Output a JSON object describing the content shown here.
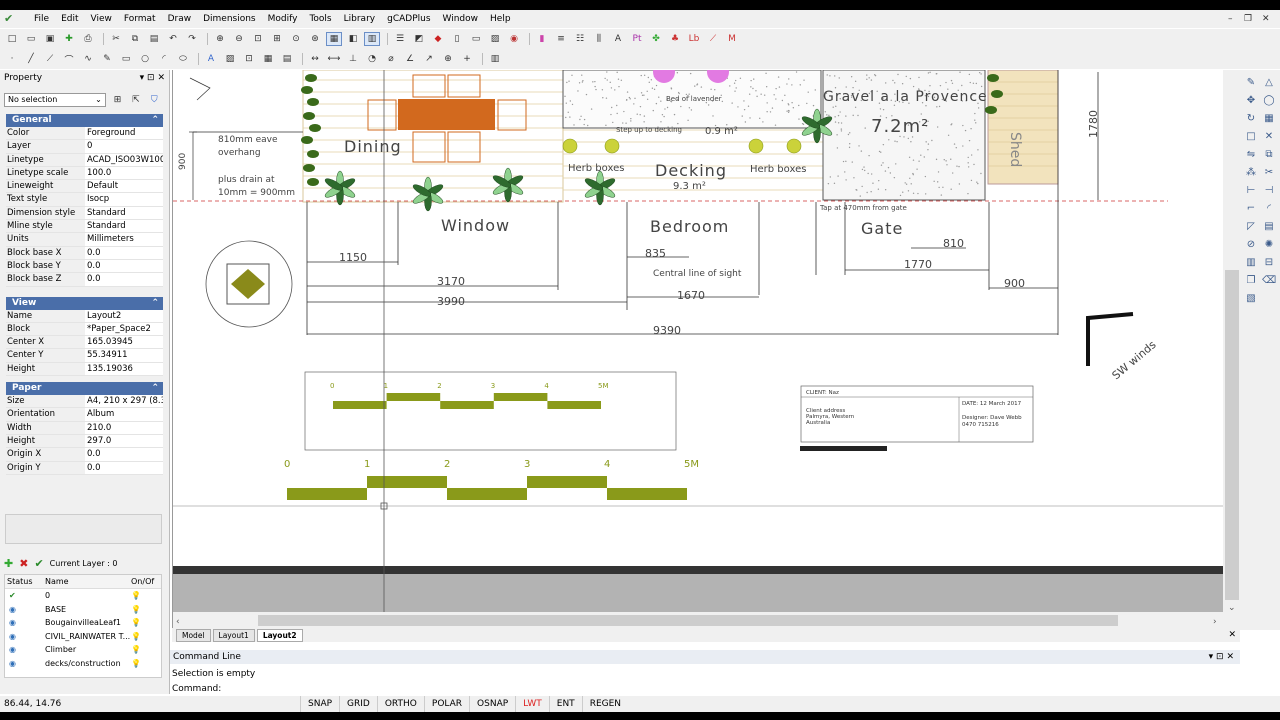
{
  "menu": [
    "File",
    "Edit",
    "View",
    "Format",
    "Draw",
    "Dimensions",
    "Modify",
    "Tools",
    "Library",
    "gCADPlus",
    "Window",
    "Help"
  ],
  "property_panel": {
    "title": "Property",
    "selection": "No selection",
    "general": {
      "title": "General",
      "rows": [
        {
          "k": "Color",
          "v": "Foreground"
        },
        {
          "k": "Layer",
          "v": "0"
        },
        {
          "k": "Linetype",
          "v": "ACAD_ISO03W100"
        },
        {
          "k": "Linetype scale",
          "v": "100.0"
        },
        {
          "k": "Lineweight",
          "v": "Default"
        },
        {
          "k": "Text style",
          "v": "Isocp"
        },
        {
          "k": "Dimension style",
          "v": "Standard"
        },
        {
          "k": "Mline style",
          "v": "Standard"
        },
        {
          "k": "Units",
          "v": "Millimeters"
        },
        {
          "k": "Block base X",
          "v": "0.0"
        },
        {
          "k": "Block base Y",
          "v": "0.0"
        },
        {
          "k": "Block base Z",
          "v": "0.0"
        }
      ]
    },
    "view": {
      "title": "View",
      "rows": [
        {
          "k": "Name",
          "v": "Layout2"
        },
        {
          "k": "Block",
          "v": "*Paper_Space2"
        },
        {
          "k": "Center X",
          "v": "165.03945"
        },
        {
          "k": "Center Y",
          "v": "55.34911"
        },
        {
          "k": "Height",
          "v": "135.19036"
        }
      ]
    },
    "paper": {
      "title": "Paper",
      "rows": [
        {
          "k": "Size",
          "v": "A4, 210 x 297 (8.3 x"
        },
        {
          "k": "Orientation",
          "v": "Album"
        },
        {
          "k": "Width",
          "v": "210.0"
        },
        {
          "k": "Height",
          "v": "297.0"
        },
        {
          "k": "Origin X",
          "v": "0.0"
        },
        {
          "k": "Origin Y",
          "v": "0.0"
        }
      ]
    }
  },
  "layers": {
    "current_label": "Current Layer : 0",
    "headers": [
      "Status",
      "Name",
      "On/Of"
    ],
    "rows": [
      {
        "status": "✔",
        "name": "0"
      },
      {
        "status": "",
        "name": "BASE"
      },
      {
        "status": "",
        "name": "BougainvilleaLeaf1"
      },
      {
        "status": "",
        "name": "CIVIL_RAINWATER T..."
      },
      {
        "status": "",
        "name": "Climber"
      },
      {
        "status": "",
        "name": "decks/construction"
      }
    ]
  },
  "drawing": {
    "labels": {
      "dining": "Dining",
      "decking": "Decking",
      "decking_area": "9.3 m²",
      "gravel": "Gravel a la Provence",
      "gravel_area": "7.2m²",
      "herb1": "Herb boxes",
      "herb2": "Herb boxes",
      "bed_lavender": "Bed of lavender",
      "step_decking": "Step up to decking",
      "area_small": "0.9 m²",
      "shed": "Shed",
      "window": "Window",
      "bedroom": "Bedroom",
      "gate": "Gate",
      "tap": "Tap at 470mm from gate",
      "eave1": "810mm eave",
      "eave2": "overhang",
      "drain1": "plus drain at",
      "drain2": "10mm = 900mm",
      "side_900": "900",
      "central": "Central line of sight",
      "sw": "SW winds",
      "dim_1780": "1780"
    },
    "dims": {
      "d1150": "1150",
      "d3170": "3170",
      "d3990": "3990",
      "d835": "835",
      "d1670": "1670",
      "d9390": "9390",
      "d810": "810",
      "d1770": "1770",
      "d900": "900"
    },
    "scale_small": [
      "0",
      "1",
      "2",
      "3",
      "4",
      "5M"
    ],
    "scale_large": [
      "0",
      "1",
      "2",
      "3",
      "4",
      "5M"
    ],
    "title_block": {
      "client": "CLIENT: Naz",
      "date": "DATE: 12 March 2017",
      "address1": "Client address",
      "address2": "Palmyra, Western",
      "address3": "Australia",
      "designer": "Designer: Dave Webb",
      "phone": "0470 715216"
    }
  },
  "tabs": [
    "Model",
    "Layout1",
    "Layout2"
  ],
  "command": {
    "title": "Command Line",
    "output": "Selection is empty",
    "prompt": "Command:"
  },
  "status": {
    "coords": "86.44, 14.76",
    "buttons": [
      "SNAP",
      "GRID",
      "ORTHO",
      "POLAR",
      "OSNAP",
      "LWT",
      "ENT",
      "REGEN"
    ],
    "active": "LWT"
  },
  "colors": {
    "accent": "#4a6ea9",
    "table": "#d2691e",
    "scale_green": "#8a9a1a",
    "hatch": "#e8d6a8"
  }
}
